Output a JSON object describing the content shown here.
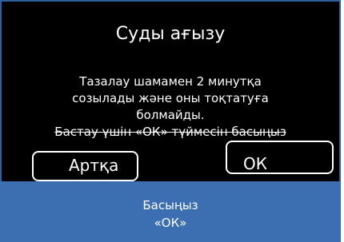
{
  "dialog": {
    "title": "Суды ағызу",
    "message_lines": [
      "Тазалау шамамен 2 минутқа",
      "созылады және оны тоқтатуға",
      "болмайды.",
      "Бастау үшін «ОК» түймесін басыңыз"
    ],
    "back_label": "Артқа",
    "ok_label": "ОК"
  },
  "footer": {
    "line1": "Басыңыз",
    "line2": "«ОК»"
  },
  "colors": {
    "panel_bg": "#000000",
    "footer_bg": "#3c6fb2",
    "text": "#ffffff"
  }
}
